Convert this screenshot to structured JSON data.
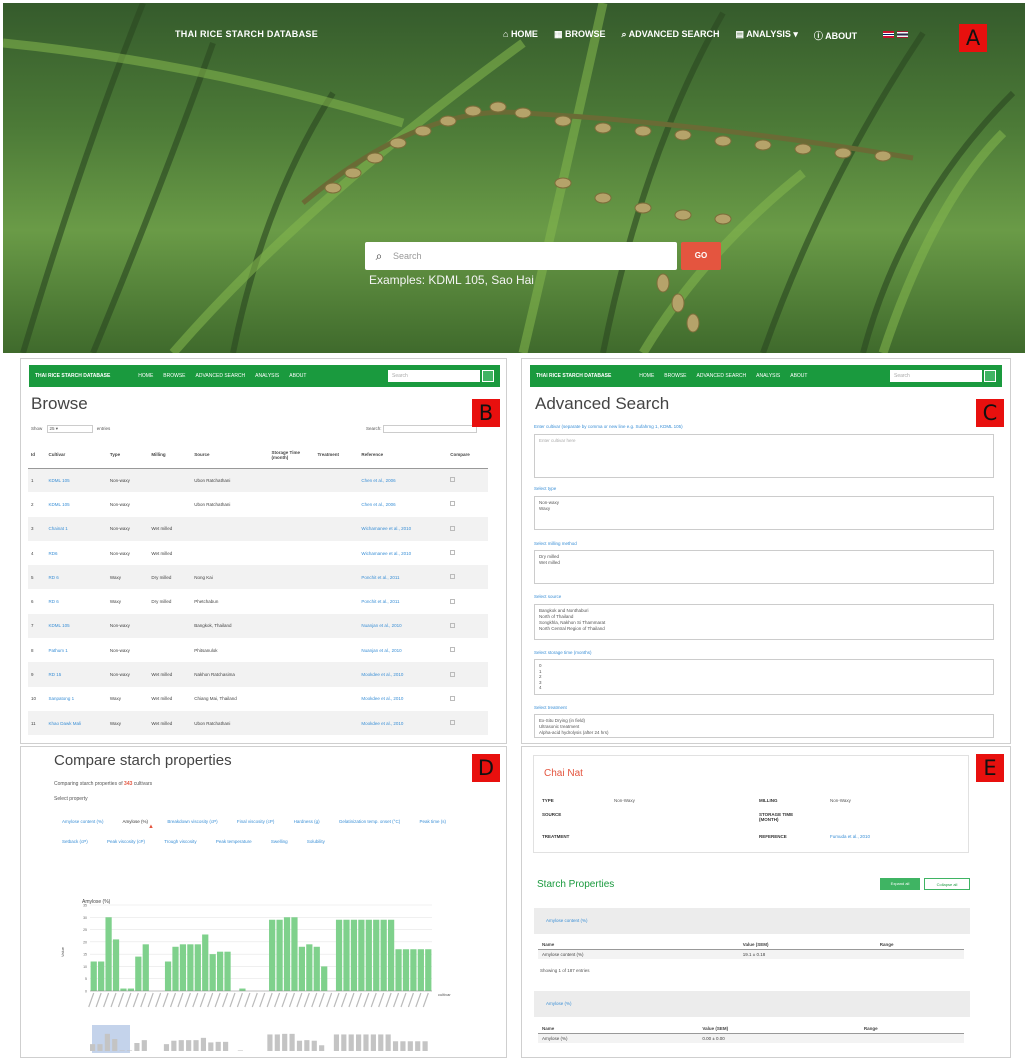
{
  "hero": {
    "site_title": "THAI RICE STARCH DATABASE",
    "menu": [
      "HOME",
      "BROWSE",
      "ADVANCED SEARCH",
      "ANALYSIS",
      "ABOUT"
    ],
    "search_placeholder": "Search",
    "go_label": "GO",
    "examples": "Examples: KDML 105, Sao Hai"
  },
  "tags": {
    "a": "A",
    "b": "B",
    "c": "C",
    "d": "D",
    "e": "E"
  },
  "mini_nav": {
    "title": "THAI RICE STARCH DATABASE",
    "menu": [
      "HOME",
      "BROWSE",
      "ADVANCED SEARCH",
      "ANALYSIS",
      "ABOUT"
    ],
    "search_placeholder": "Search"
  },
  "browse": {
    "title": "Browse",
    "show_label": "Show",
    "show_value": "25",
    "entries_label": "entries",
    "search_label": "Search:",
    "columns": [
      "Id",
      "Cultivar",
      "Type",
      "Milling",
      "Source",
      "Storage Time (month)",
      "Treatment",
      "Reference",
      "Compare"
    ],
    "rows": [
      {
        "id": "1",
        "cultivar": "KDML 105",
        "type": "Non-waxy",
        "milling": "",
        "source": "Ubon Ratchathani",
        "reference": "Chen et al., 2006"
      },
      {
        "id": "2",
        "cultivar": "KDML 105",
        "type": "Non-waxy",
        "milling": "",
        "source": "Ubon Ratchathani",
        "reference": "Chen et al., 2006"
      },
      {
        "id": "3",
        "cultivar": "Chainat 1",
        "type": "Non-waxy",
        "milling": "Wet milled",
        "source": "",
        "reference": "Wichamanee et al., 2010"
      },
      {
        "id": "4",
        "cultivar": "RD6",
        "type": "Non-waxy",
        "milling": "Wet milled",
        "source": "",
        "reference": "Wichamanee et al., 2010"
      },
      {
        "id": "5",
        "cultivar": "RD 6",
        "type": "Waxy",
        "milling": "Dry milled",
        "source": "Nong Kai",
        "reference": "Ponchit et al., 2011"
      },
      {
        "id": "6",
        "cultivar": "RD 6",
        "type": "Waxy",
        "milling": "Dry milled",
        "source": "Phetchabun",
        "reference": "Ponchit et al., 2011"
      },
      {
        "id": "7",
        "cultivar": "KDML 105",
        "type": "Non-waxy",
        "milling": "",
        "source": "Bangkok, Thailand",
        "reference": "Nuanjan et al., 2010"
      },
      {
        "id": "8",
        "cultivar": "Pathum 1",
        "type": "Non-waxy",
        "milling": "",
        "source": "Phitsanulok",
        "reference": "Nuanjan et al., 2010"
      },
      {
        "id": "9",
        "cultivar": "RD 15",
        "type": "Non-waxy",
        "milling": "Wet milled",
        "source": "Nakhon Ratchasima",
        "reference": "Mookdee et al., 2010"
      },
      {
        "id": "10",
        "cultivar": "Sanpatong 1",
        "type": "Waxy",
        "milling": "Wet milled",
        "source": "Chiang Mai, Thailand",
        "reference": "Mookdee et al., 2010"
      },
      {
        "id": "11",
        "cultivar": "Khao Dawk Mali",
        "type": "Waxy",
        "milling": "Wet milled",
        "source": "Ubon Ratchathani",
        "reference": "Mookdee et al., 2010"
      }
    ]
  },
  "advanced": {
    "title": "Advanced Search",
    "cultivar_label": "Enter cultivar (separate by comma or new line e.g. Sufahrng 1, KDML 105)",
    "cultivar_placeholder": "Enter cultivar here",
    "type_label": "Select type",
    "type_options": [
      "Non-waxy",
      "Waxy"
    ],
    "milling_label": "Select milling method",
    "milling_options": [
      "Dry milled",
      "Wet milled"
    ],
    "source_label": "Select source",
    "source_options": [
      "Bangkok and Nonthaburi",
      "North of Thailand",
      "Songkhla, Nakhon Si Thammarat",
      "North Central Region of Thailand"
    ],
    "storage_label": "Select storage time (months)",
    "storage_options": [
      "0",
      "1",
      "2",
      "3",
      "4"
    ],
    "treatment_label": "Select treatment",
    "treatment_options": [
      "Ex-Situ Drying (in field)",
      "Ultrasonic treatment",
      "Alpha-acid hydrolysis (after 24 hrs)"
    ]
  },
  "compare": {
    "title": "Compare starch properties",
    "subtitle_prefix": "Comparing starch properties of",
    "count": "343",
    "subtitle_suffix": "cultivars",
    "select_label": "Select property",
    "properties": [
      "Amylose content (%)",
      "Amylose (%)",
      "Breakdown viscosity (cP)",
      "Final viscosity (cP)",
      "Hardness (g)",
      "Gelatinization temp. onset (°C)",
      "Peak time (s)",
      "Setback (cP)",
      "Peak viscosity (cP)",
      "Trough viscosity",
      "Peak temperature",
      "Swelling",
      "Solubility"
    ],
    "active_property": "Amylose (%)"
  },
  "chart_data": {
    "type": "bar",
    "title": "Amylose (%)",
    "ylabel": "Value",
    "xlabel": "cultivar",
    "ylim": [
      0,
      35
    ],
    "values": [
      12,
      12,
      30,
      21,
      1,
      1,
      14,
      19,
      0,
      0,
      12,
      18,
      19,
      19,
      19,
      23,
      15,
      16,
      16,
      0,
      1,
      0,
      0,
      0,
      29,
      29,
      30,
      30,
      18,
      19,
      18,
      10,
      0,
      29,
      29,
      29,
      29,
      29,
      29,
      29,
      29,
      17,
      17,
      17,
      17,
      17
    ]
  },
  "detail": {
    "name": "Chai Nat",
    "type_label": "TYPE",
    "type_value": "Non-Waxy",
    "milling_label": "MILLING",
    "milling_value": "Non-Waxy",
    "source_label": "SOURCE",
    "storage_label": "STORAGE TIME (MONTH)",
    "treatment_label": "TREATMENT",
    "reference_label": "REFERENCE",
    "reference_value": "Fumuda et al., 2010",
    "starch_title": "Starch Properties",
    "btn_expand": "Expand all",
    "btn_collapse": "Collapse all",
    "section1": "Amylose content (%)",
    "section2": "Amylose (%)",
    "col_name": "Name",
    "col_value": "Value (SEM)",
    "col_range": "Range",
    "row1_name": "Amylose content (%)",
    "row1_value": "19.1 ± 0.18",
    "row2_name": "Amylose (%)",
    "row2_value": "0.00 ± 0.00",
    "note": "Showing 1 of 187 entries"
  }
}
